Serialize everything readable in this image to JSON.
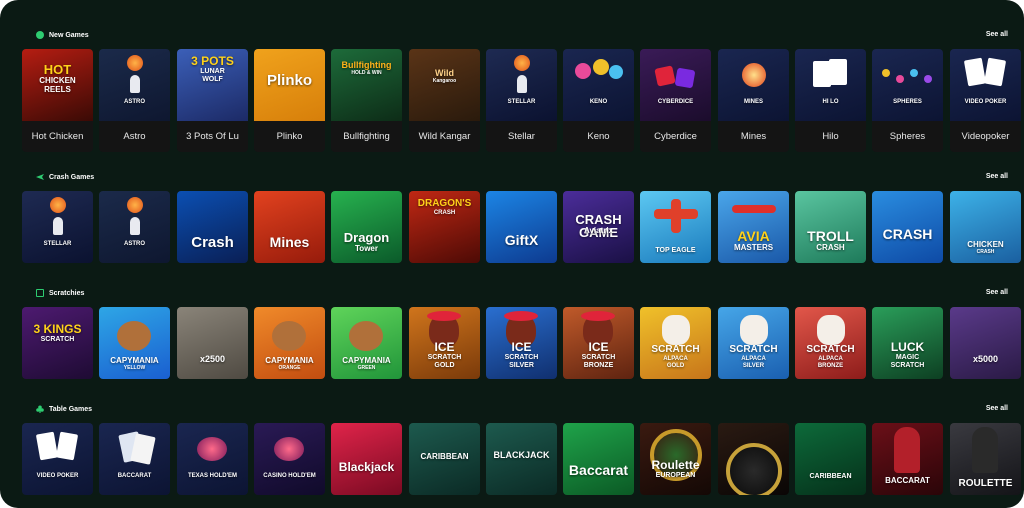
{
  "sections": [
    {
      "title": "New Games",
      "icon": "green-circle-icon",
      "see_all": "See all",
      "games": [
        {
          "name": "Hot Chicken",
          "art": [
            "HOT",
            "CHICKEN",
            "REELS"
          ]
        },
        {
          "name": "Astro",
          "art": [
            "ASTRO"
          ]
        },
        {
          "name": "3 Pots Of Lu",
          "art": [
            "3 POTS",
            "LUNAR",
            "WOLF"
          ]
        },
        {
          "name": "Plinko",
          "art": [
            "Plinko"
          ]
        },
        {
          "name": "Bullfighting",
          "art": [
            "Bullfighting",
            "HOLD & WIN"
          ]
        },
        {
          "name": "Wild Kangar",
          "art": [
            "Wild",
            "Kangaroo"
          ]
        },
        {
          "name": "Stellar",
          "art": [
            "STELLAR"
          ]
        },
        {
          "name": "Keno",
          "art": [
            "KENO"
          ]
        },
        {
          "name": "Cyberdice",
          "art": [
            "CYBERDICE"
          ]
        },
        {
          "name": "Mines",
          "art": [
            "MINES"
          ]
        },
        {
          "name": "Hilo",
          "art": [
            "HI LO"
          ]
        },
        {
          "name": "Spheres",
          "art": [
            "SPHERES"
          ]
        },
        {
          "name": "Videopoker",
          "art": [
            "VIDEO POKER"
          ]
        }
      ]
    },
    {
      "title": "Crash Games",
      "icon": "plane-icon",
      "see_all": "See all",
      "games": [
        {
          "art": [
            "STELLAR"
          ]
        },
        {
          "art": [
            "ASTRO"
          ]
        },
        {
          "art": [
            "Crash"
          ]
        },
        {
          "art": [
            "Mines"
          ]
        },
        {
          "art": [
            "Dragon",
            "Tower"
          ]
        },
        {
          "art": [
            "DRAGON'S",
            "CRASH"
          ]
        },
        {
          "art": [
            "GiftX"
          ]
        },
        {
          "art": [
            "CRASH GAME",
            "Aviatrix"
          ]
        },
        {
          "art": [
            "TOP EAGLE"
          ]
        },
        {
          "art": [
            "AVIA",
            "MASTERS"
          ]
        },
        {
          "art": [
            "TROLL",
            "CRASH"
          ]
        },
        {
          "art": [
            "CRASH"
          ]
        },
        {
          "art": [
            "CHICKEN",
            "CRASH"
          ]
        }
      ]
    },
    {
      "title": "Scratchies",
      "icon": "ticket-icon",
      "see_all": "See all",
      "games": [
        {
          "art": [
            "3 KINGS",
            "SCRATCH"
          ]
        },
        {
          "art": [
            "CAPYMANIA",
            "YELLOW"
          ]
        },
        {
          "art": [
            "x2500"
          ]
        },
        {
          "art": [
            "CAPYMANIA",
            "ORANGE"
          ]
        },
        {
          "art": [
            "CAPYMANIA",
            "GREEN"
          ]
        },
        {
          "art": [
            "ICE",
            "SCRATCH",
            "GOLD"
          ]
        },
        {
          "art": [
            "ICE",
            "SCRATCH",
            "SILVER"
          ]
        },
        {
          "art": [
            "ICE",
            "SCRATCH",
            "BRONZE"
          ]
        },
        {
          "art": [
            "SCRATCH",
            "ALPACA",
            "GOLD"
          ]
        },
        {
          "art": [
            "SCRATCH",
            "ALPACA",
            "SILVER"
          ]
        },
        {
          "art": [
            "SCRATCH",
            "ALPACA",
            "BRONZE"
          ]
        },
        {
          "art": [
            "LUCK",
            "MAGIC",
            "SCRATCH"
          ]
        },
        {
          "art": [
            "x5000"
          ]
        }
      ]
    },
    {
      "title": "Table Games",
      "icon": "club-icon",
      "see_all": "See all",
      "games": [
        {
          "art": [
            "VIDEO POKER"
          ]
        },
        {
          "art": [
            "BACCARAT"
          ]
        },
        {
          "art": [
            "TEXAS HOLD'EM"
          ]
        },
        {
          "art": [
            "CASINO HOLD'EM"
          ]
        },
        {
          "art": [
            "Blackjack"
          ]
        },
        {
          "art": [
            "CARIBBEAN"
          ]
        },
        {
          "art": [
            "BLACKJACK"
          ]
        },
        {
          "art": [
            "Baccarat"
          ]
        },
        {
          "art": [
            "Roulette",
            "EUROPEAN"
          ]
        },
        {
          "art": []
        },
        {
          "art": [
            "CARIBBEAN"
          ]
        },
        {
          "art": [
            "BACCARAT"
          ]
        },
        {
          "art": [
            "ROULETTE"
          ]
        }
      ]
    }
  ],
  "colors": {
    "page_bg": "#0b1a14",
    "caption_bg": "#141414",
    "accent_green": "#2ecc71"
  }
}
